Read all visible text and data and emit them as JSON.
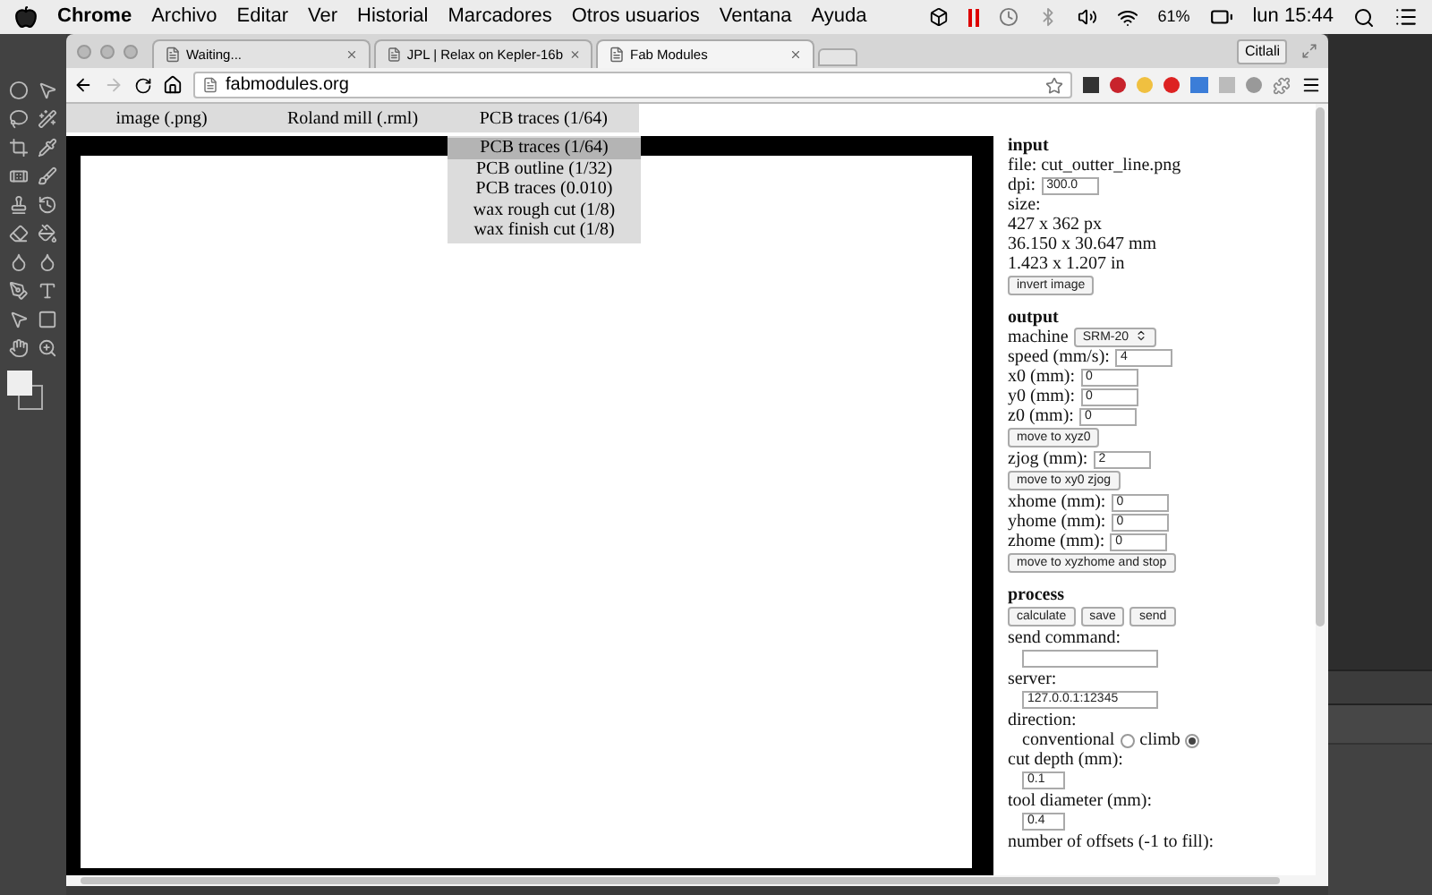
{
  "menubar": {
    "app": "Chrome",
    "items": [
      "Archivo",
      "Editar",
      "Ver",
      "Historial",
      "Marcadores",
      "Otros usuarios",
      "Ventana",
      "Ayuda"
    ],
    "battery": "61%",
    "clock": "lun 15:44"
  },
  "browser": {
    "tabs": [
      {
        "title": "Waiting...",
        "selected": false
      },
      {
        "title": "JPL | Relax on Kepler-16b",
        "selected": false
      },
      {
        "title": "Fab Modules",
        "selected": true
      }
    ],
    "profile": "Citlali",
    "url": "fabmodules.org"
  },
  "page": {
    "menu": [
      {
        "label": "image (.png)"
      },
      {
        "label": "Roland mill (.rml)"
      },
      {
        "label": "PCB traces (1/64)"
      }
    ],
    "dropdown": [
      {
        "label": "PCB traces (1/64)",
        "selected": true
      },
      {
        "label": "PCB outline (1/32)",
        "selected": false
      },
      {
        "label": "PCB traces (0.010)",
        "selected": false
      },
      {
        "label": "wax rough cut (1/8)",
        "selected": false
      },
      {
        "label": "wax finish cut (1/8)",
        "selected": false
      }
    ],
    "sections": [
      {
        "heading": "input",
        "rows": [
          {
            "kind": "text",
            "text": "file: cut_outter_line.png"
          },
          {
            "kind": "field",
            "label": "dpi:",
            "value": "300.0"
          },
          {
            "kind": "text",
            "text": "size:"
          },
          {
            "kind": "text",
            "text": "427 x 362 px"
          },
          {
            "kind": "text",
            "text": "36.150 x 30.647 mm"
          },
          {
            "kind": "text",
            "text": "1.423 x 1.207 in"
          },
          {
            "kind": "buttons",
            "labels": [
              "invert image"
            ]
          }
        ]
      },
      {
        "heading": "output",
        "rows": [
          {
            "kind": "select",
            "label": "machine",
            "value": "SRM-20"
          },
          {
            "kind": "field",
            "label": "speed (mm/s):",
            "value": "4"
          },
          {
            "kind": "field",
            "label": "x0 (mm):",
            "value": "0"
          },
          {
            "kind": "field",
            "label": "y0 (mm):",
            "value": "0"
          },
          {
            "kind": "field",
            "label": "z0 (mm):",
            "value": "0"
          },
          {
            "kind": "buttons",
            "labels": [
              "move to xyz0"
            ]
          },
          {
            "kind": "field",
            "label": "zjog (mm):",
            "value": "2"
          },
          {
            "kind": "buttons",
            "labels": [
              "move to xy0 zjog"
            ]
          },
          {
            "kind": "field",
            "label": "xhome (mm):",
            "value": "0"
          },
          {
            "kind": "field",
            "label": "yhome (mm):",
            "value": "0"
          },
          {
            "kind": "field",
            "label": "zhome (mm):",
            "value": "0"
          },
          {
            "kind": "buttons",
            "labels": [
              "move to xyzhome and stop"
            ]
          }
        ]
      },
      {
        "heading": "process",
        "rows": [
          {
            "kind": "buttons",
            "labels": [
              "calculate",
              "save",
              "send"
            ]
          },
          {
            "kind": "text",
            "text": "send command:"
          },
          {
            "kind": "wide_field"
          },
          {
            "kind": "text",
            "text": "server:"
          },
          {
            "kind": "wide_field",
            "value": "127.0.0.1:12345"
          },
          {
            "kind": "text",
            "text": "direction:"
          },
          {
            "kind": "radio",
            "options": [
              {
                "label": "conventional",
                "selected": false
              },
              {
                "label": "climb",
                "selected": true
              }
            ]
          },
          {
            "kind": "text",
            "text": "cut depth (mm):"
          },
          {
            "kind": "short_field",
            "value": "0.1"
          },
          {
            "kind": "text",
            "text": "tool diameter (mm):"
          },
          {
            "kind": "short_field",
            "value": "0.4"
          },
          {
            "kind": "text",
            "text": "number of offsets (-1 to fill):"
          }
        ]
      }
    ]
  }
}
